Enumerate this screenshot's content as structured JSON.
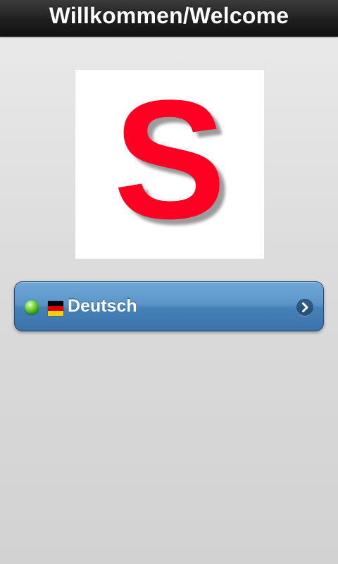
{
  "header": {
    "title": "Willkommen/Welcome"
  },
  "logo": {
    "letter": "S",
    "letter_color": "#ff0022",
    "background_color": "#ffffff"
  },
  "language_list": {
    "items": [
      {
        "label": "Deutsch",
        "status_icon": "green-dot-icon",
        "flag_icon": "german-flag-icon",
        "flag_colors": [
          "#000000",
          "#dd0000",
          "#ffce00"
        ],
        "arrow_icon": "chevron-right-icon",
        "accent_color": "#4a86bd"
      }
    ]
  }
}
